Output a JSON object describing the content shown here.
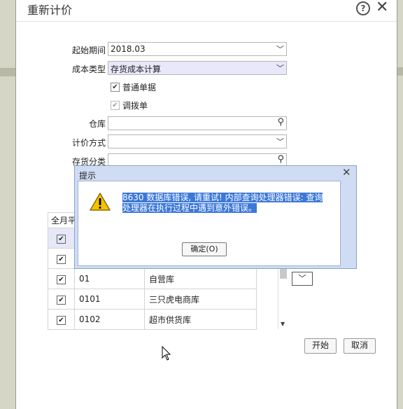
{
  "dialog": {
    "title": "重新计价"
  },
  "form": {
    "start_period_label": "起始期间",
    "start_period_value": "2018.03",
    "cost_type_label": "成本类型",
    "cost_type_value": "存货成本计算",
    "checkbox_normal": "普通单据",
    "checkbox_transfer": "调拨单",
    "warehouse_label": "仓库",
    "pricing_method_label": "计价方式",
    "inventory_category_label": "存货分类",
    "partial_label": "存"
  },
  "grid": {
    "header_partial": "全月平",
    "rows": [
      {
        "code": "",
        "name": ""
      },
      {
        "code": "",
        "name": ""
      },
      {
        "code": "01",
        "name": "自营库"
      },
      {
        "code": "0101",
        "name": "三只虎电商库"
      },
      {
        "code": "0102",
        "name": "超市供货库"
      }
    ]
  },
  "buttons": {
    "start": "开始",
    "cancel": "取消"
  },
  "modal": {
    "title": "提示",
    "message": "8630 数据库错误, 请重试! 内部查询处理器错误: 查询处理器在执行过程中遇到意外错误。",
    "ok": "确定(O)"
  }
}
